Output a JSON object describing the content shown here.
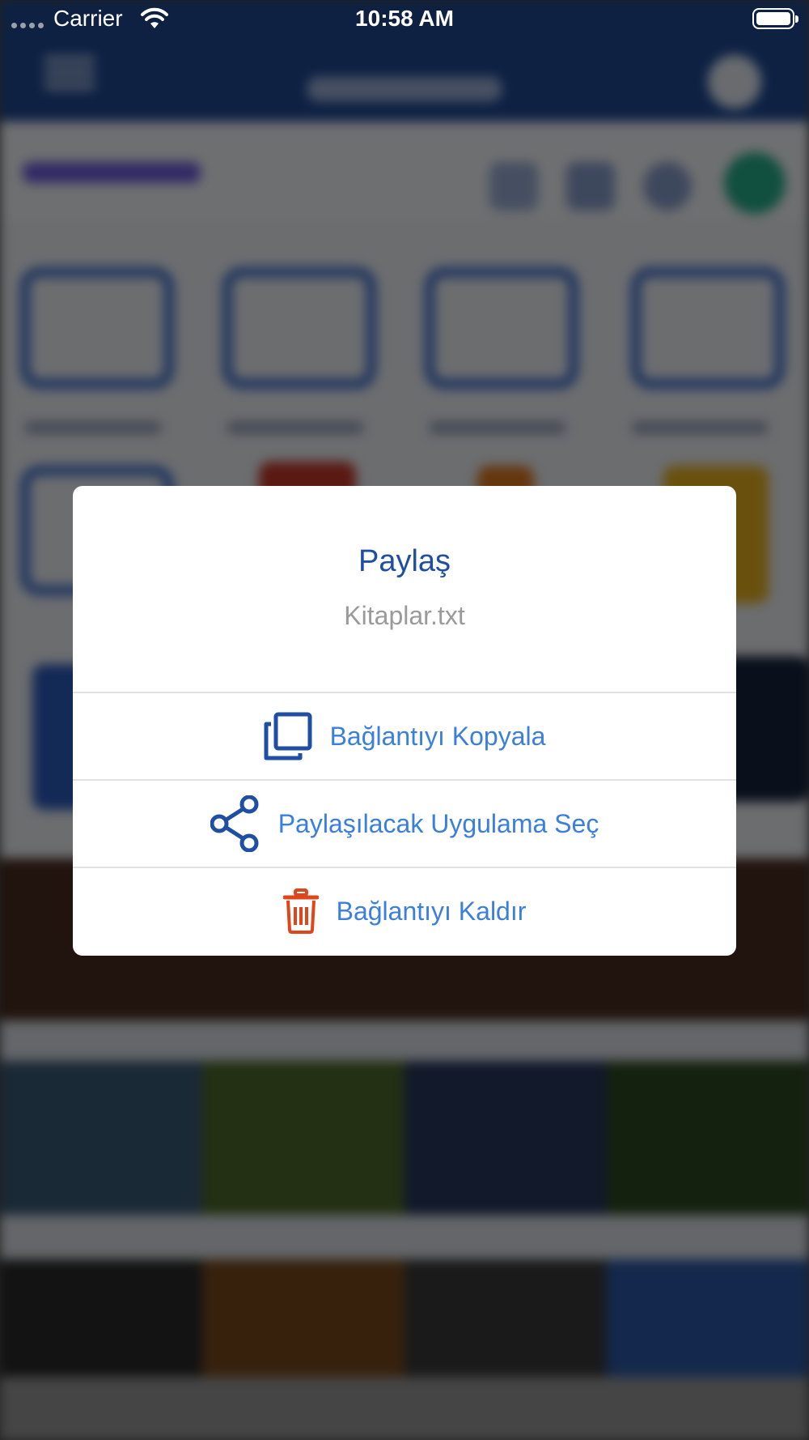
{
  "status_bar": {
    "carrier": "Carrier",
    "time": "10:58 AM"
  },
  "dialog": {
    "title": "Paylaş",
    "subtitle": "Kitaplar.txt",
    "actions": [
      {
        "label": "Bağlantıyı Kopyala",
        "icon": "copy-icon",
        "color": "#1e4fa3"
      },
      {
        "label": "Paylaşılacak Uygulama Seç",
        "icon": "share-icon",
        "color": "#1e4fa3"
      },
      {
        "label": "Bağlantıyı Kaldır",
        "icon": "trash-icon",
        "color": "#e0461c"
      }
    ]
  },
  "colors": {
    "title": "#1e4fa3",
    "action_text": "#3a7fdc",
    "subtitle": "#9a9a9a",
    "nav_bar": "#1f4a96"
  }
}
